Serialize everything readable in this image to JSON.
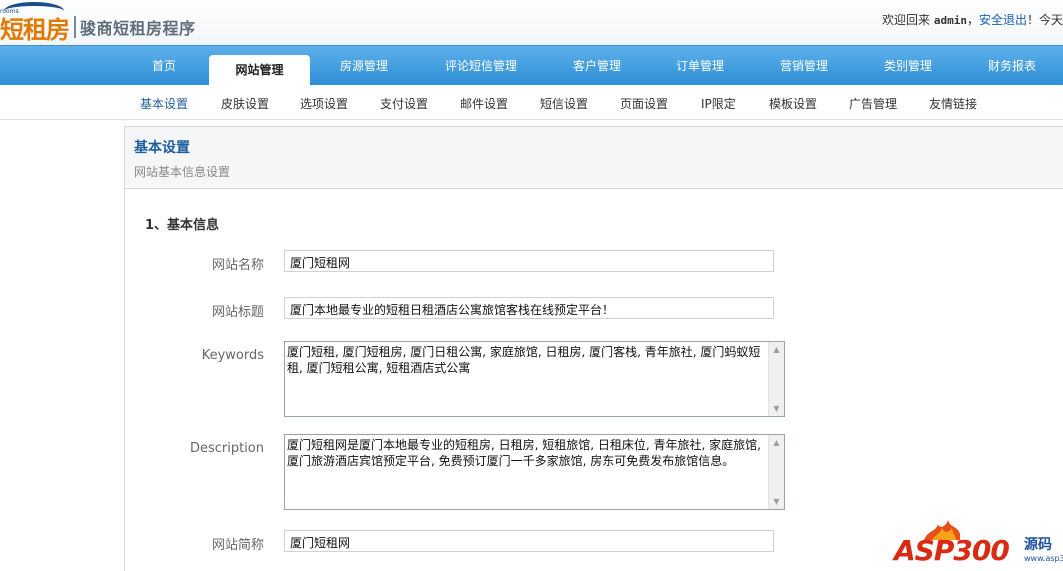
{
  "brand": {
    "logo_small": "rooms",
    "logo_big": "短租房",
    "product_name": "骏商短租房程序"
  },
  "user_bar": {
    "welcome": "欢迎回来",
    "username": "admin",
    "separator": "，",
    "logout_label": "安全退出",
    "trailing": "！今天"
  },
  "nav": {
    "items": [
      {
        "label": "首页"
      },
      {
        "label": "网站管理"
      },
      {
        "label": "房源管理"
      },
      {
        "label": "评论短信管理"
      },
      {
        "label": "客户管理"
      },
      {
        "label": "订单管理"
      },
      {
        "label": "营销管理"
      },
      {
        "label": "类别管理"
      },
      {
        "label": "财务报表"
      }
    ],
    "active": "网站管理"
  },
  "subnav": {
    "items": [
      {
        "label": "基本设置"
      },
      {
        "label": "皮肤设置"
      },
      {
        "label": "选项设置"
      },
      {
        "label": "支付设置"
      },
      {
        "label": "邮件设置"
      },
      {
        "label": "短信设置"
      },
      {
        "label": "页面设置"
      },
      {
        "label": "IP限定"
      },
      {
        "label": "模板设置"
      },
      {
        "label": "广告管理"
      },
      {
        "label": "友情链接"
      }
    ],
    "active": "基本设置"
  },
  "page_header": {
    "title": "基本设置",
    "subtitle": "网站基本信息设置"
  },
  "section": {
    "title": "1、基本信息"
  },
  "form": {
    "site_name": {
      "label": "网站名称",
      "value": "厦门短租网"
    },
    "site_title": {
      "label": "网站标题",
      "value": "厦门本地最专业的短租日租酒店公寓旅馆客栈在线预定平台！"
    },
    "keywords": {
      "label": "Keywords",
      "value": "厦门短租, 厦门短租房, 厦门日租公寓, 家庭旅馆, 日租房, 厦门客栈, 青年旅社, 厦门蚂蚁短租, 厦门短租公寓, 短租酒店式公寓"
    },
    "description": {
      "label": "Description",
      "value": "厦门短租网是厦门本地最专业的短租房, 日租房, 短租旅馆, 日租床位, 青年旅社, 家庭旅馆, 厦门旅游酒店宾馆预定平台, 免费预订厦门一千多家旅馆, 房东可免费发布旅馆信息。"
    },
    "site_short_name": {
      "label": "网站简称",
      "value": "厦门短租网"
    }
  },
  "watermark": {
    "main": "ASP300",
    "sub": "源码",
    "url": "www.asp300.com"
  }
}
